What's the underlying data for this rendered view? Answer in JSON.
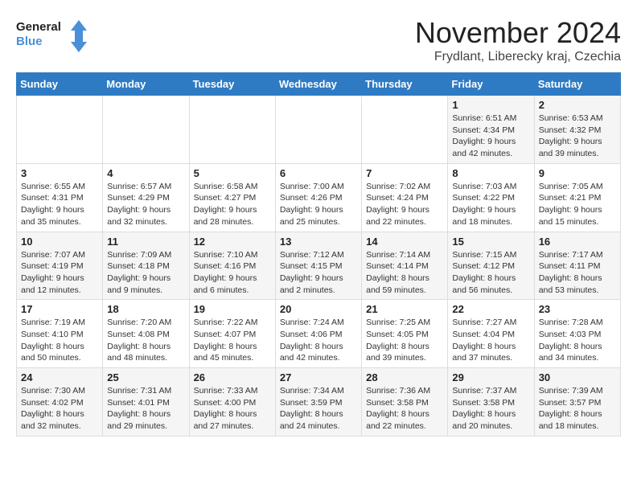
{
  "logo": {
    "line1": "General",
    "line2": "Blue"
  },
  "title": "November 2024",
  "location": "Frydlant, Liberecky kraj, Czechia",
  "weekdays": [
    "Sunday",
    "Monday",
    "Tuesday",
    "Wednesday",
    "Thursday",
    "Friday",
    "Saturday"
  ],
  "weeks": [
    [
      {
        "day": "",
        "info": ""
      },
      {
        "day": "",
        "info": ""
      },
      {
        "day": "",
        "info": ""
      },
      {
        "day": "",
        "info": ""
      },
      {
        "day": "",
        "info": ""
      },
      {
        "day": "1",
        "info": "Sunrise: 6:51 AM\nSunset: 4:34 PM\nDaylight: 9 hours\nand 42 minutes."
      },
      {
        "day": "2",
        "info": "Sunrise: 6:53 AM\nSunset: 4:32 PM\nDaylight: 9 hours\nand 39 minutes."
      }
    ],
    [
      {
        "day": "3",
        "info": "Sunrise: 6:55 AM\nSunset: 4:31 PM\nDaylight: 9 hours\nand 35 minutes."
      },
      {
        "day": "4",
        "info": "Sunrise: 6:57 AM\nSunset: 4:29 PM\nDaylight: 9 hours\nand 32 minutes."
      },
      {
        "day": "5",
        "info": "Sunrise: 6:58 AM\nSunset: 4:27 PM\nDaylight: 9 hours\nand 28 minutes."
      },
      {
        "day": "6",
        "info": "Sunrise: 7:00 AM\nSunset: 4:26 PM\nDaylight: 9 hours\nand 25 minutes."
      },
      {
        "day": "7",
        "info": "Sunrise: 7:02 AM\nSunset: 4:24 PM\nDaylight: 9 hours\nand 22 minutes."
      },
      {
        "day": "8",
        "info": "Sunrise: 7:03 AM\nSunset: 4:22 PM\nDaylight: 9 hours\nand 18 minutes."
      },
      {
        "day": "9",
        "info": "Sunrise: 7:05 AM\nSunset: 4:21 PM\nDaylight: 9 hours\nand 15 minutes."
      }
    ],
    [
      {
        "day": "10",
        "info": "Sunrise: 7:07 AM\nSunset: 4:19 PM\nDaylight: 9 hours\nand 12 minutes."
      },
      {
        "day": "11",
        "info": "Sunrise: 7:09 AM\nSunset: 4:18 PM\nDaylight: 9 hours\nand 9 minutes."
      },
      {
        "day": "12",
        "info": "Sunrise: 7:10 AM\nSunset: 4:16 PM\nDaylight: 9 hours\nand 6 minutes."
      },
      {
        "day": "13",
        "info": "Sunrise: 7:12 AM\nSunset: 4:15 PM\nDaylight: 9 hours\nand 2 minutes."
      },
      {
        "day": "14",
        "info": "Sunrise: 7:14 AM\nSunset: 4:14 PM\nDaylight: 8 hours\nand 59 minutes."
      },
      {
        "day": "15",
        "info": "Sunrise: 7:15 AM\nSunset: 4:12 PM\nDaylight: 8 hours\nand 56 minutes."
      },
      {
        "day": "16",
        "info": "Sunrise: 7:17 AM\nSunset: 4:11 PM\nDaylight: 8 hours\nand 53 minutes."
      }
    ],
    [
      {
        "day": "17",
        "info": "Sunrise: 7:19 AM\nSunset: 4:10 PM\nDaylight: 8 hours\nand 50 minutes."
      },
      {
        "day": "18",
        "info": "Sunrise: 7:20 AM\nSunset: 4:08 PM\nDaylight: 8 hours\nand 48 minutes."
      },
      {
        "day": "19",
        "info": "Sunrise: 7:22 AM\nSunset: 4:07 PM\nDaylight: 8 hours\nand 45 minutes."
      },
      {
        "day": "20",
        "info": "Sunrise: 7:24 AM\nSunset: 4:06 PM\nDaylight: 8 hours\nand 42 minutes."
      },
      {
        "day": "21",
        "info": "Sunrise: 7:25 AM\nSunset: 4:05 PM\nDaylight: 8 hours\nand 39 minutes."
      },
      {
        "day": "22",
        "info": "Sunrise: 7:27 AM\nSunset: 4:04 PM\nDaylight: 8 hours\nand 37 minutes."
      },
      {
        "day": "23",
        "info": "Sunrise: 7:28 AM\nSunset: 4:03 PM\nDaylight: 8 hours\nand 34 minutes."
      }
    ],
    [
      {
        "day": "24",
        "info": "Sunrise: 7:30 AM\nSunset: 4:02 PM\nDaylight: 8 hours\nand 32 minutes."
      },
      {
        "day": "25",
        "info": "Sunrise: 7:31 AM\nSunset: 4:01 PM\nDaylight: 8 hours\nand 29 minutes."
      },
      {
        "day": "26",
        "info": "Sunrise: 7:33 AM\nSunset: 4:00 PM\nDaylight: 8 hours\nand 27 minutes."
      },
      {
        "day": "27",
        "info": "Sunrise: 7:34 AM\nSunset: 3:59 PM\nDaylight: 8 hours\nand 24 minutes."
      },
      {
        "day": "28",
        "info": "Sunrise: 7:36 AM\nSunset: 3:58 PM\nDaylight: 8 hours\nand 22 minutes."
      },
      {
        "day": "29",
        "info": "Sunrise: 7:37 AM\nSunset: 3:58 PM\nDaylight: 8 hours\nand 20 minutes."
      },
      {
        "day": "30",
        "info": "Sunrise: 7:39 AM\nSunset: 3:57 PM\nDaylight: 8 hours\nand 18 minutes."
      }
    ]
  ]
}
